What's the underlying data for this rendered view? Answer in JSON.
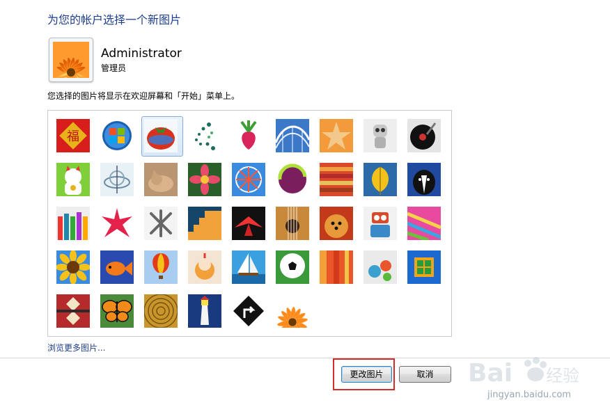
{
  "dialog": {
    "title": "为您的帐户选择一个新图片",
    "description": "您选择的图片将显示在欢迎屏幕和「开始」菜单上。",
    "browse_link": "浏览更多图片..."
  },
  "user": {
    "name": "Administrator",
    "role": "管理员"
  },
  "pictures": {
    "selected_index": 2,
    "rows": [
      [
        "fu-character",
        "windows-logo",
        "tomato-robot",
        "dot-swirl",
        "radish",
        "roller-coaster",
        "starfish",
        "robot-toy",
        "record-player"
      ],
      [
        "lucky-cat",
        "gyroscope",
        "kitten",
        "pink-flower",
        "ferris-wheel",
        "ball",
        "fabric-stack",
        "yellow-leaf",
        "border-collie"
      ],
      [
        "crayons",
        "red-star",
        "jacks",
        "stairs",
        "paper-crane",
        "guitar",
        "pomeranian",
        "tin-robot",
        "scarf"
      ],
      [
        "sunflower",
        "fish",
        "hot-air-balloon",
        "doll",
        "sailboat",
        "soccer-ball",
        "fabric",
        "marbles",
        "green-window"
      ],
      [
        "rug-pattern",
        "butterfly",
        "wicker",
        "lighthouse",
        "road-sign",
        "orange-flower"
      ]
    ]
  },
  "buttons": {
    "change_picture": "更改图片",
    "cancel": "取消"
  },
  "watermark": {
    "brand": "Baidu经验",
    "url": "jingyan.baidu.com"
  }
}
